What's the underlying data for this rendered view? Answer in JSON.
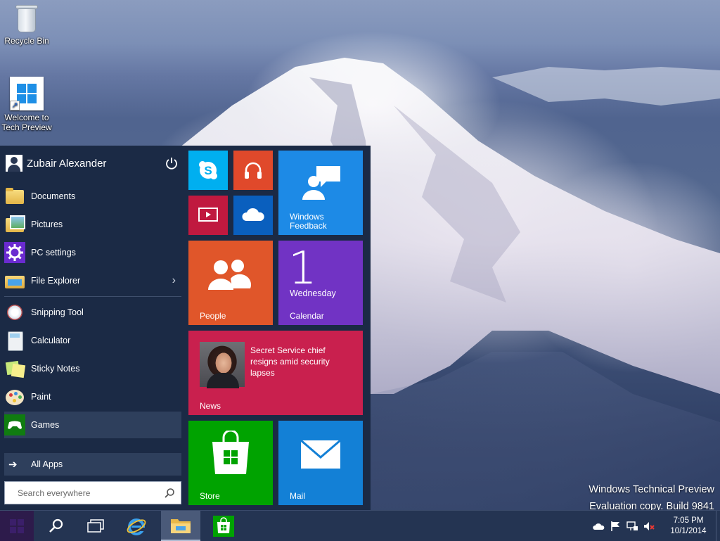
{
  "desktop": {
    "recycle_bin_label": "Recycle Bin",
    "welcome_label_line1": "Welcome to",
    "welcome_label_line2": "Tech Preview",
    "watermark_line1": "Windows Technical Preview",
    "watermark_line2": "Evaluation copy. Build 9841"
  },
  "start_menu": {
    "user_name": "Zubair Alexander",
    "places": [
      {
        "label": "Documents",
        "icon": "documents-folder-icon"
      },
      {
        "label": "Pictures",
        "icon": "pictures-folder-icon"
      },
      {
        "label": "PC settings",
        "icon": "gear-icon"
      },
      {
        "label": "File Explorer",
        "icon": "file-explorer-icon"
      }
    ],
    "apps": [
      {
        "label": "Snipping Tool",
        "icon": "snipping-tool-icon"
      },
      {
        "label": "Calculator",
        "icon": "calculator-icon"
      },
      {
        "label": "Sticky Notes",
        "icon": "sticky-notes-icon"
      },
      {
        "label": "Paint",
        "icon": "paint-icon"
      },
      {
        "label": "Games",
        "icon": "games-controller-icon"
      }
    ],
    "all_apps_label": "All Apps",
    "search_placeholder": "Search everywhere"
  },
  "tiles": {
    "feedback_line1": "Windows",
    "feedback_line2": "Feedback",
    "people_label": "People",
    "calendar_date": "1",
    "calendar_day": "Wednesday",
    "calendar_label": "Calendar",
    "news_headline": "Secret Service chief resigns amid security lapses",
    "news_label": "News",
    "store_label": "Store",
    "mail_label": "Mail"
  },
  "taskbar": {
    "time": "7:05 PM",
    "date": "10/1/2014"
  },
  "colors": {
    "skype_tile": "#00aff0",
    "music_tile": "#e0492b",
    "video_tile": "#c0193f",
    "onedrive_tile": "#0a5fbe",
    "feedback_tile": "#1d8ae6",
    "people_tile": "#e0562a",
    "calendar_tile": "#7133c4",
    "news_tile": "#c9204e",
    "store_tile": "#00a300",
    "mail_tile": "#1380d6",
    "start_menu_bg": "#1b2a45",
    "taskbar_bg": "#243452"
  }
}
